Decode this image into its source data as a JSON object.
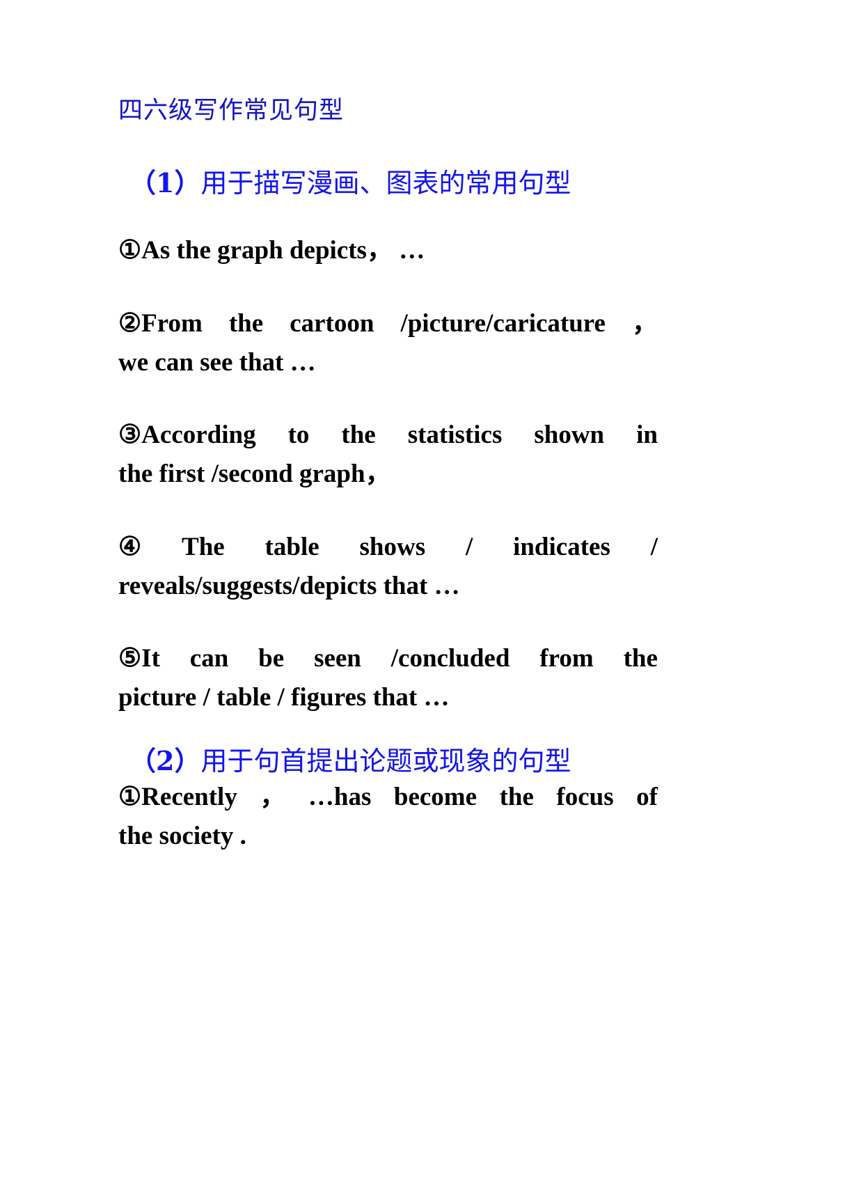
{
  "document": {
    "title": "四六级写作常见句型",
    "title_color": "#1414c8",
    "heading_color": "#1414ee",
    "body_color": "#000000",
    "background": "#ffffff"
  },
  "sections": [
    {
      "heading": "（1）用于描写漫画、图表的常用句型",
      "heading_number": "（1）",
      "heading_text": "用于描写漫画、图表的常用句型",
      "items": [
        {
          "marker": "①",
          "text": "As the graph depicts，…",
          "lines": [
            {
              "words": [
                "①As",
                "the",
                "graph",
                "depicts",
                "，",
                "…"
              ]
            }
          ]
        },
        {
          "marker": "②",
          "text": "From the cartoon /picture/caricature，we can see that …",
          "lines": [
            {
              "words": [
                "②From",
                "the",
                "cartoon",
                "/picture/caricature",
                "，"
              ]
            },
            {
              "words": [
                "we can see that",
                "…"
              ]
            }
          ]
        },
        {
          "marker": "③",
          "text": "According to the statistics shown in the first /second graph，",
          "lines": [
            {
              "words": [
                "③According",
                "to",
                "the",
                "statistics",
                "shown",
                "in"
              ]
            },
            {
              "words": [
                "the first /second graph",
                "，"
              ]
            }
          ]
        },
        {
          "marker": "④",
          "text": "The table shows / indicates / reveals/suggests/depicts that …",
          "lines": [
            {
              "words": [
                "④",
                "The",
                "table",
                "shows",
                "/",
                "indicates",
                "/"
              ]
            },
            {
              "words": [
                "reveals/suggests/depicts that",
                "…"
              ]
            }
          ]
        },
        {
          "marker": "⑤",
          "text": "It can be seen /concluded from the picture / table / figures that …",
          "lines": [
            {
              "words": [
                "⑤It",
                "can",
                "be",
                "seen",
                "/concluded",
                "from",
                "the"
              ]
            },
            {
              "words": [
                "picture / table / figures that",
                "…"
              ]
            }
          ]
        }
      ]
    },
    {
      "heading": "（2）用于句首提出论题或现象的句型",
      "heading_number": "（2）",
      "heading_text": "用于句首提出论题或现象的句型",
      "items": [
        {
          "marker": "①",
          "text": "Recently，…has become the focus of the society .",
          "lines": [
            {
              "words": [
                "①Recently",
                "，",
                "…has",
                "become",
                "the",
                "focus",
                "of"
              ]
            },
            {
              "words": [
                "the society .",
                ""
              ]
            }
          ]
        }
      ]
    }
  ],
  "text": {
    "title": "四六级写作常见句型",
    "s1_heading_num": "（1）",
    "s1_heading_body": "用于描写漫画、图表的常用句型",
    "s2_heading_num": "（2）",
    "s2_heading_body": "用于句首提出论题或现象的句型",
    "i1_l1_w1": "①As",
    "i1_l1_w2": "the",
    "i1_l1_w3": "graph",
    "i1_l1_w4": "depicts",
    "i1_l1_w5": "，",
    "i1_l1_w6": "…",
    "i2_l1_w1": "②From",
    "i2_l1_w2": "the",
    "i2_l1_w3": "cartoon",
    "i2_l1_w4": "/picture/caricature",
    "i2_l1_w5": "，",
    "i2_l2": "we can see that  …",
    "i3_l1_w1": "③According",
    "i3_l1_w2": "to",
    "i3_l1_w3": "the",
    "i3_l1_w4": "statistics",
    "i3_l1_w5": "shown",
    "i3_l1_w6": "in",
    "i3_l2": "the first /second graph，",
    "i4_l1_w1": "④",
    "i4_l1_w2": "The",
    "i4_l1_w3": "table",
    "i4_l1_w4": "shows",
    "i4_l1_w5": "/",
    "i4_l1_w6": "indicates",
    "i4_l1_w7": "/",
    "i4_l2": "reveals/suggests/depicts that  …",
    "i5_l1_w1": "⑤It",
    "i5_l1_w2": "can",
    "i5_l1_w3": "be",
    "i5_l1_w4": "seen",
    "i5_l1_w5": "/concluded",
    "i5_l1_w6": "from",
    "i5_l1_w7": "the",
    "i5_l2": "picture / table / figures that  …",
    "i6_l1_w1": "①Recently",
    "i6_l1_w2": "，",
    "i6_l1_w3": "…has",
    "i6_l1_w4": "become",
    "i6_l1_w5": "the",
    "i6_l1_w6": "focus",
    "i6_l1_w7": "of",
    "i6_l2": "the society ."
  }
}
